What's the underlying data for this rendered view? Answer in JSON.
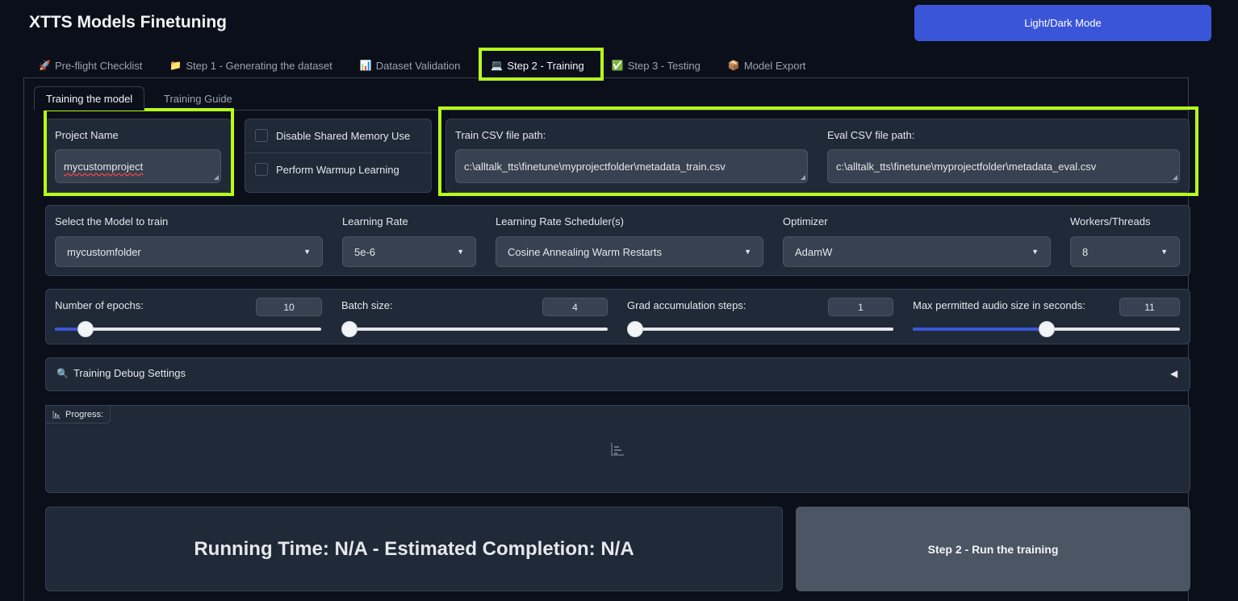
{
  "app": {
    "title": "XTTS Models Finetuning",
    "theme_button": "Light/Dark Mode",
    "accent_color": "#3b55d9",
    "highlight_color": "#b6ff1a"
  },
  "tabs": [
    {
      "label": "Pre-flight Checklist",
      "icon": "rocket-icon",
      "glyph": "🚀"
    },
    {
      "label": "Step 1 - Generating the dataset",
      "icon": "folder-icon",
      "glyph": "📁"
    },
    {
      "label": "Dataset Validation",
      "icon": "bar-chart-icon",
      "glyph": "📊"
    },
    {
      "label": "Step 2 - Training",
      "icon": "laptop-icon",
      "glyph": "💻"
    },
    {
      "label": "Step 3 - Testing",
      "icon": "check-box-icon",
      "glyph": "✅"
    },
    {
      "label": "Model Export",
      "icon": "package-icon",
      "glyph": "📦"
    }
  ],
  "subtabs": {
    "training_model": "Training the model",
    "training_guide": "Training Guide"
  },
  "project": {
    "label": "Project Name",
    "value": "mycustomproject"
  },
  "options": {
    "disable_shared_memory": "Disable Shared Memory Use",
    "perform_warmup": "Perform Warmup Learning"
  },
  "paths": {
    "train_label": "Train CSV file path:",
    "train_value": "c:\\alltalk_tts\\finetune\\myprojectfolder\\metadata_train.csv",
    "eval_label": "Eval CSV file path:",
    "eval_value": "c:\\alltalk_tts\\finetune\\myprojectfolder\\metadata_eval.csv"
  },
  "model_settings": {
    "model_label": "Select the Model to train",
    "model_value": "mycustomfolder",
    "lr_label": "Learning Rate",
    "lr_value": "5e-6",
    "scheduler_label": "Learning Rate Scheduler(s)",
    "scheduler_value": "Cosine Annealing Warm Restarts",
    "optimizer_label": "Optimizer",
    "optimizer_value": "AdamW",
    "workers_label": "Workers/Threads",
    "workers_value": "8"
  },
  "sliders": {
    "epochs_label": "Number of epochs:",
    "epochs_value": "10",
    "epochs_fraction": 0.115,
    "batch_label": "Batch size:",
    "batch_value": "4",
    "batch_fraction": 0.0,
    "grad_label": "Grad accumulation steps:",
    "grad_value": "1",
    "grad_fraction": 0.0,
    "audio_label": "Max permitted audio size in seconds:",
    "audio_value": "11",
    "audio_fraction": 0.5
  },
  "debug": {
    "label": "Training Debug Settings",
    "icon": "magnifier-icon",
    "glyph": "🔍",
    "toggle": "◀"
  },
  "progress": {
    "label": "Progress:"
  },
  "status": {
    "text": "Running Time: N/A - Estimated Completion: N/A"
  },
  "run_button": "Step 2 - Run the training"
}
